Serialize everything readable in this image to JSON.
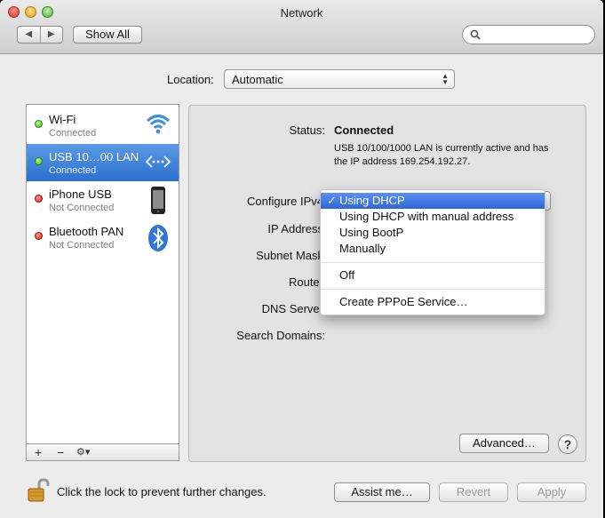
{
  "window": {
    "title": "Network"
  },
  "toolbar": {
    "back_label": "◀",
    "forward_label": "▶",
    "show_all_label": "Show All",
    "search_placeholder": ""
  },
  "location": {
    "label": "Location:",
    "value": "Automatic"
  },
  "services": [
    {
      "name": "Wi-Fi",
      "status": "Connected",
      "status_color": "#2fae12",
      "icon": "wifi-icon",
      "selected": false
    },
    {
      "name": "USB 10…00 LAN",
      "status": "Connected",
      "status_color": "#2fae12",
      "icon": "ethernet-icon",
      "selected": true
    },
    {
      "name": "iPhone USB",
      "status": "Not Connected",
      "status_color": "#d61b10",
      "icon": "iphone-icon",
      "selected": false
    },
    {
      "name": "Bluetooth PAN",
      "status": "Not Connected",
      "status_color": "#d61b10",
      "icon": "bluetooth-icon",
      "selected": false
    }
  ],
  "sidebar_tools": {
    "add": "+",
    "remove": "−",
    "gear": "⚙▾"
  },
  "detail": {
    "status_label": "Status:",
    "status_value": "Connected",
    "status_description": "USB 10/100/1000 LAN is currently active and has the IP address 169.254.192.27.",
    "configure_ipv4_label": "Configure IPv4",
    "ip_address_label": "IP Address",
    "subnet_mask_label": "Subnet Mask",
    "router_label": "Router",
    "dns_server_label": "DNS Server",
    "search_domains_label": "Search Domains:",
    "advanced_label": "Advanced…",
    "help_label": "?"
  },
  "ipv4_menu": {
    "check": "✓",
    "items": [
      "Using DHCP",
      "Using DHCP with manual address",
      "Using BootP",
      "Manually",
      "Off",
      "Create PPPoE Service…"
    ],
    "selected": "Using DHCP"
  },
  "footer": {
    "lock_text": "Click the lock to prevent further changes.",
    "assist_label": "Assist me…",
    "revert_label": "Revert",
    "apply_label": "Apply"
  },
  "colors": {
    "selection": "#2d6fd1",
    "connected": "#2fae12",
    "not_connected": "#d61b10"
  }
}
